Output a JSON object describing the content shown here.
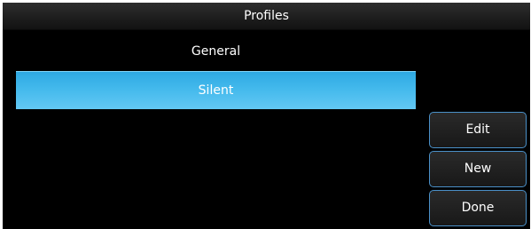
{
  "window": {
    "title": "Profiles"
  },
  "profiles": [
    {
      "label": "General",
      "selected": false
    },
    {
      "label": "Silent",
      "selected": true
    }
  ],
  "buttons": {
    "edit_label": "Edit",
    "new_label": "New",
    "done_label": "Done"
  },
  "colors": {
    "selection_accent": "#43b9ec",
    "button_border": "#4a90c8",
    "background": "#000000"
  }
}
